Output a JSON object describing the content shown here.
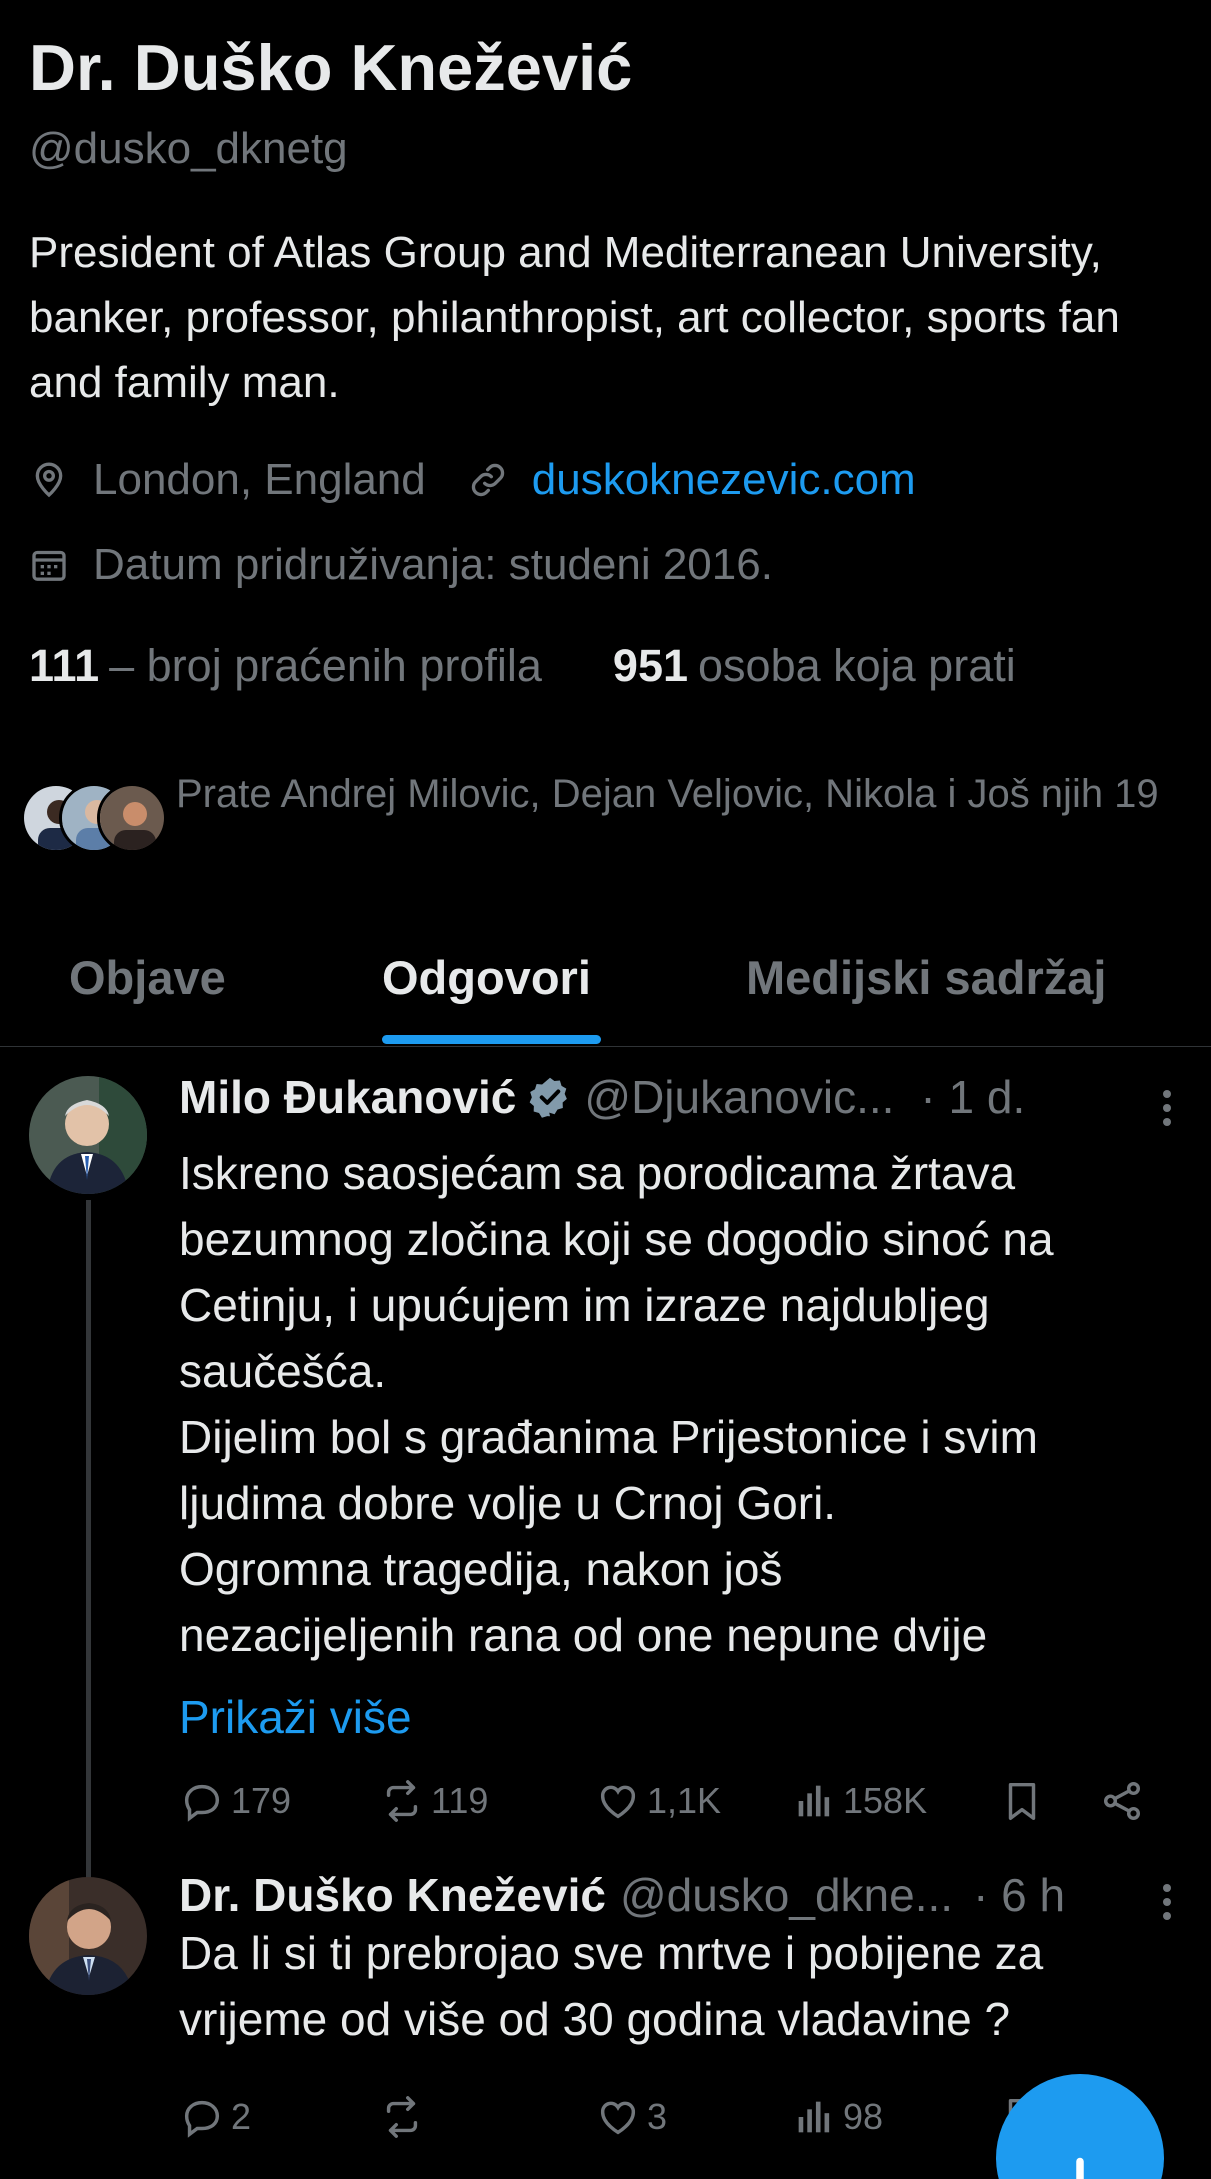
{
  "profile": {
    "display_name": "Dr. Duško Knežević",
    "handle": "@dusko_dknetg",
    "bio": "President of Atlas Group and Mediterranean University, banker, professor, philanthropist, art collector, sports fan and family man.",
    "location": "London, England",
    "website": "duskoknezevic.com",
    "joined": "Datum pridruživanja: studeni 2016.",
    "following_count": "111",
    "following_label": "– broj praćenih profila",
    "followers_count": "951",
    "followers_label": "osoba koja prati",
    "followed_by": "Prate Andrej Milovic, Dejan Veljovic, Nikola i Još njih 19"
  },
  "tabs": [
    {
      "label": "Objave",
      "active": false
    },
    {
      "label": "Odgovori",
      "active": true
    },
    {
      "label": "Medijski sadržaj",
      "active": false
    }
  ],
  "posts": [
    {
      "name": "Milo Đukanović",
      "verified": true,
      "handle": "@Djukanovic...",
      "time": "· 1 d.",
      "lines": [
        "Iskreno saosjećam sa  porodicama žrtava",
        "bezumnog zločina koji se dogodio sinoć na",
        "Cetinju, i upućujem im izraze najdubljeg",
        "saučešća.",
        "Dijelim bol s građanima Prijestonice i svim",
        "ljudima dobre volje u Crnoj Gori.",
        "Ogromna tragedija, nakon još",
        "nezacijeljenih rana od one nepune dvije"
      ],
      "show_more": "Prikaži više",
      "replies": "179",
      "reposts": "119",
      "likes": "1,1K",
      "views": "158K"
    },
    {
      "name": "Dr. Duško Knežević",
      "handle": "@dusko_dkne...",
      "time": "· 6 h",
      "lines": [
        "Da li si ti prebrojao sve mrtve i pobijene za",
        "vrijeme od više od 30 godina vladavine ?"
      ],
      "replies": "2",
      "reposts": "",
      "likes": "3",
      "views": "98"
    }
  ],
  "colors": {
    "background": "#000000",
    "text": "#e7e9ea",
    "muted": "#71767b",
    "accent": "#1d9bf0"
  },
  "icons": [
    "location-icon",
    "link-icon",
    "calendar-icon",
    "verified-icon",
    "more-icon",
    "reply-icon",
    "repost-icon",
    "like-icon",
    "views-icon",
    "bookmark-icon",
    "share-icon",
    "compose-icon"
  ]
}
